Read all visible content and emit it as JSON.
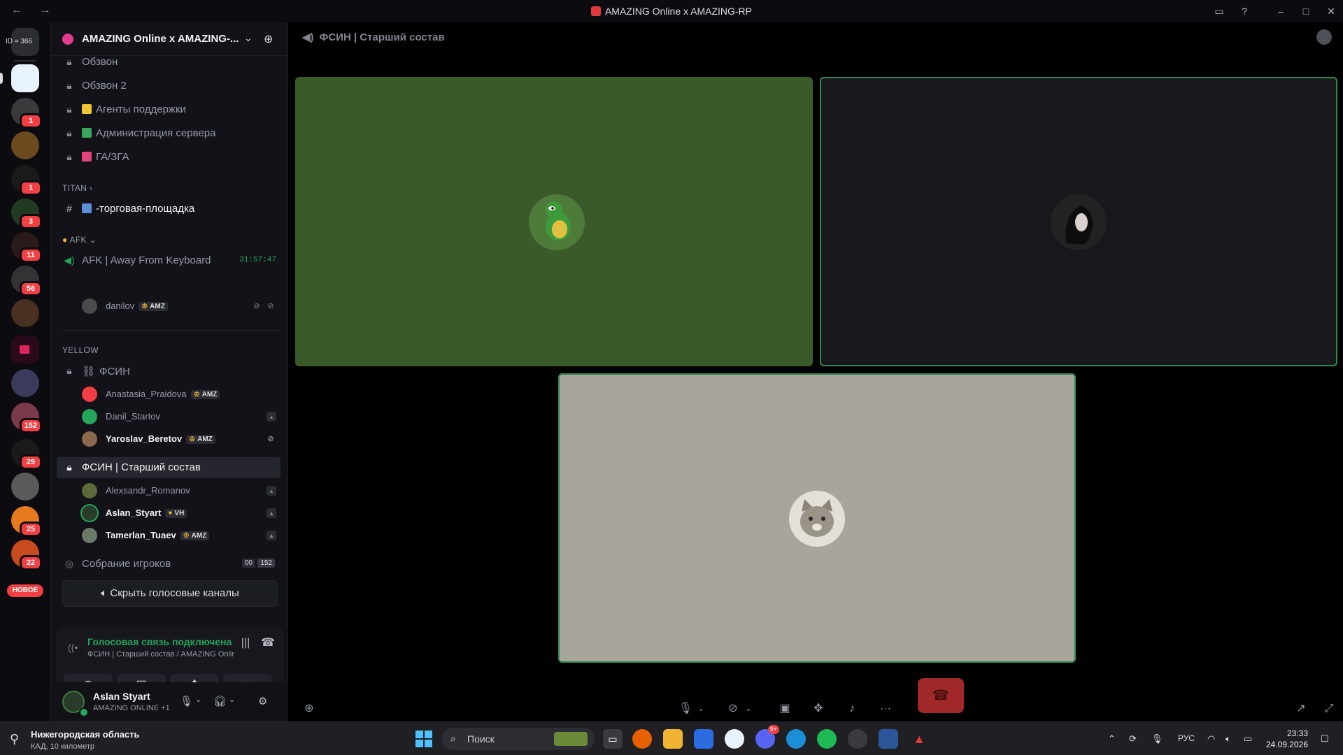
{
  "window": {
    "title": "AMAZING Online x AMAZING-RP"
  },
  "rail": {
    "top_label": "ID = 366",
    "badges": [
      "1",
      "1",
      "3",
      "11",
      "56",
      "152",
      "29",
      "25",
      "22"
    ],
    "new_label": "НОВОЕ"
  },
  "guild": {
    "name": "AMAZING Online x AMAZING-..."
  },
  "channels": {
    "top": [
      {
        "label": "Обзвон"
      },
      {
        "label": "Обзвон 2"
      },
      {
        "label": "Агенты поддержки",
        "color": "#f0c532"
      },
      {
        "label": "Администрация сервера",
        "color": "#3ba55d"
      },
      {
        "label": "ГА/ЗГА",
        "color": "#e0457b"
      }
    ],
    "titan_category": "TITAN",
    "trade": "-торговая-площадка",
    "afk_category": "AFK",
    "afk_channel": "AFK | Away From Keyboard",
    "afk_timer": "31:57:47",
    "afk_user": "danilov",
    "afk_user_tag": "AMZ",
    "yellow_category": "YELLOW",
    "fsin": "ФСИН",
    "fsin_users": [
      {
        "name": "Anastasia_Praidova",
        "tag": "AMZ"
      },
      {
        "name": "Danil_Startov",
        "tag": ""
      },
      {
        "name": "Yaroslav_Beretov",
        "tag": "AMZ"
      }
    ],
    "fsin_senior": "ФСИН | Старший состав",
    "senior_users": [
      {
        "name": "Alexsandr_Romanov",
        "tag": ""
      },
      {
        "name": "Aslan_Styart",
        "tag": "VH"
      },
      {
        "name": "Tamerlan_Tuaev",
        "tag": "AMZ"
      }
    ],
    "gathering": "Собрание игроков",
    "gathering_count_a": "00",
    "gathering_count_b": "152",
    "hide_voice": "Скрыть голосовые каналы"
  },
  "voice": {
    "status": "Голосовая связь подключена",
    "sub": "ФСИН | Старший состав / AMAZING Online x ..."
  },
  "user": {
    "name": "Aslan Styart",
    "status": "AMAZING ONLINE +1"
  },
  "stage": {
    "header": "ФСИН | Старший состав"
  },
  "taskbar": {
    "weather_title": "Нижегородская область",
    "weather_sub": "КАД, 10 километр",
    "search_placeholder": "Поиск",
    "lang": "РУС",
    "time": "23:33",
    "date": "24.09.2026",
    "discord_badge": "9+"
  },
  "colors": {
    "accent_green": "#23a55a",
    "hangup": "#a12828",
    "tile1_bg": "#3b5a2a",
    "tile2_bg": "#18181c",
    "tile3_bg": "#a8a69c"
  }
}
